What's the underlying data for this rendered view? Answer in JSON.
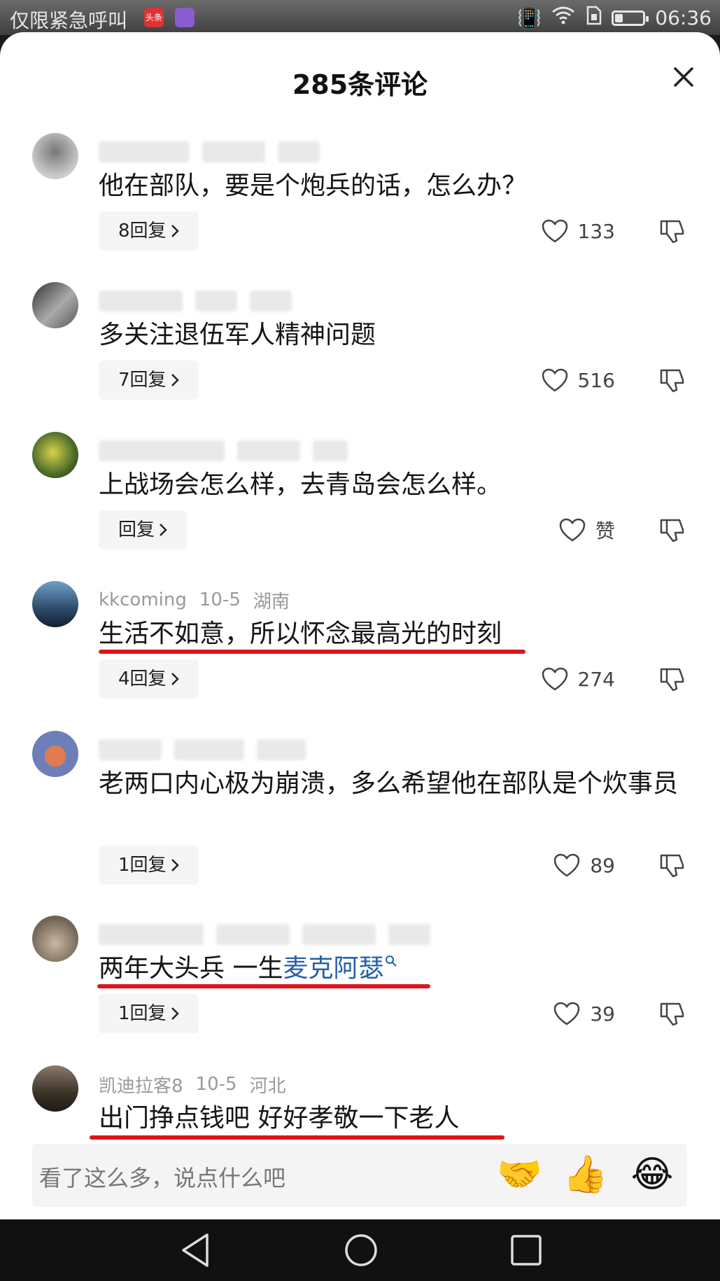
{
  "status_bar": {
    "carrier": "仅限紧急呼叫",
    "app_icon_text": "头条",
    "time": "06:36",
    "battery_level": 0.3
  },
  "sheet": {
    "title": "285条评论"
  },
  "comments": [
    {
      "username": "",
      "date": "",
      "location": "",
      "text": "他在部队，要是个炮兵的话，怎么办？",
      "reply_label": "8回复",
      "likes": "133",
      "highlighted": false
    },
    {
      "username": "",
      "date": "",
      "location": "",
      "text": "多关注退伍军人精神问题",
      "reply_label": "7回复",
      "likes": "516",
      "highlighted": false
    },
    {
      "username": "",
      "date": "",
      "location": "",
      "text": "上战场会怎么样，去青岛会怎么样。",
      "reply_label": "回复",
      "likes": "赞",
      "highlighted": false
    },
    {
      "username": "kkcoming",
      "date": "10-5",
      "location": "湖南",
      "text": "生活不如意，所以怀念最高光的时刻",
      "reply_label": "4回复",
      "likes": "274",
      "highlighted": true
    },
    {
      "username": "",
      "date": "",
      "location": "",
      "text": "老两口内心极为崩溃，多么希望他在部队是个炊事员",
      "reply_label": "1回复",
      "likes": "89",
      "highlighted": false
    },
    {
      "username": "",
      "date": "",
      "location": "",
      "text": "两年大头兵 一生",
      "link_text": "麦克阿瑟",
      "reply_label": "1回复",
      "likes": "39",
      "highlighted": true
    },
    {
      "username": "凯迪拉客8",
      "date": "10-5",
      "location": "河北",
      "text": "出门挣点钱吧 好好孝敬一下老人",
      "highlighted": true
    }
  ],
  "input": {
    "placeholder": "看了这么多，说点什么吧"
  },
  "emojis": [
    "🤝",
    "👍",
    "😂"
  ],
  "colors": {
    "underline": "#e0141c",
    "link": "#2560a8"
  }
}
